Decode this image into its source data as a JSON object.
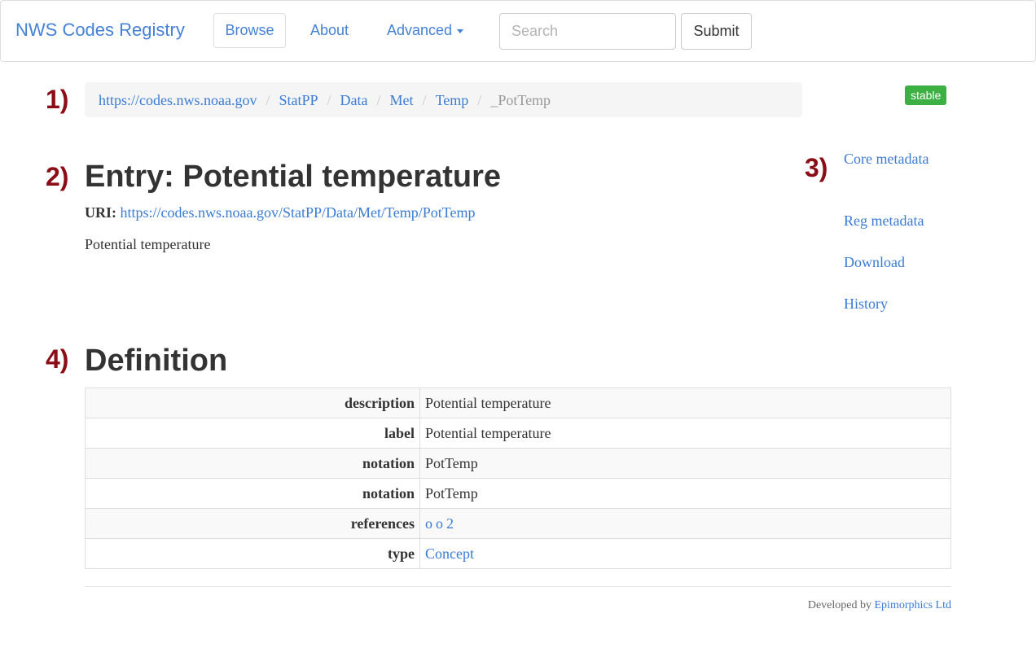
{
  "navbar": {
    "brand": "NWS Codes Registry",
    "browse_label": "Browse",
    "about_label": "About",
    "advanced_label": "Advanced",
    "search_placeholder": "Search",
    "submit_label": "Submit"
  },
  "markers": [
    "1)",
    "2)",
    "3)",
    "4)"
  ],
  "breadcrumb": {
    "items": [
      "https://codes.nws.noaa.gov",
      "StatPP",
      "Data",
      "Met",
      "Temp"
    ],
    "separator": "/",
    "current": "_PotTemp"
  },
  "status_badge": "stable",
  "entry": {
    "title": "Entry: Potential temperature",
    "uri_label": "URI:",
    "uri": "https://codes.nws.noaa.gov/StatPP/Data/Met/Temp/PotTemp",
    "description": "Potential temperature"
  },
  "side_nav": [
    "Core metadata",
    "Reg metadata",
    "Download",
    "History"
  ],
  "definition": {
    "heading": "Definition",
    "rows": [
      {
        "key": "description",
        "value": "Potential temperature"
      },
      {
        "key": "label",
        "value": "Potential temperature"
      },
      {
        "key": "notation",
        "value": "PotTemp"
      },
      {
        "key": "notation",
        "value": "PotTemp"
      },
      {
        "key": "references",
        "links": [
          "o",
          "o",
          "2"
        ]
      },
      {
        "key": "type",
        "link": "Concept"
      }
    ]
  },
  "footer": {
    "prefix": "Developed by",
    "link": "Epimorphics Ltd"
  },
  "colors": {
    "link": "#3a7bd5",
    "badge": "#3cb043",
    "marker": "#8b0d16"
  }
}
